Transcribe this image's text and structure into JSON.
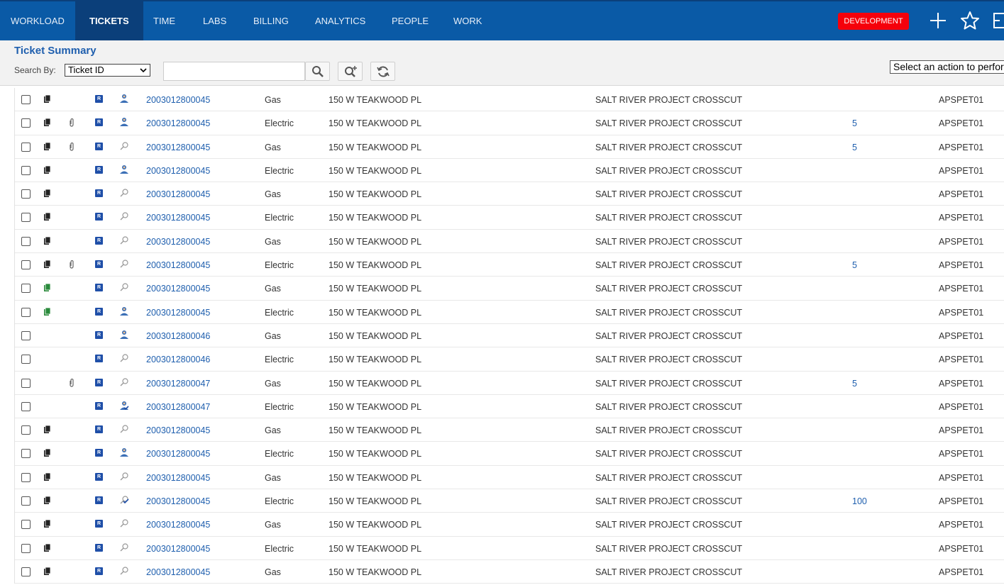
{
  "nav": {
    "items": [
      {
        "label": "WORKLOAD",
        "active": false
      },
      {
        "label": "TICKETS",
        "active": true
      },
      {
        "label": "TIME",
        "active": false
      },
      {
        "label": "LABS",
        "active": false
      },
      {
        "label": "BILLING",
        "active": false
      },
      {
        "label": "ANALYTICS",
        "active": false
      },
      {
        "label": "PEOPLE",
        "active": false
      },
      {
        "label": "WORK",
        "active": false
      }
    ],
    "env_badge": "DEVELOPMENT",
    "icons": [
      "plus-icon",
      "star-icon",
      "exit-icon"
    ]
  },
  "header": {
    "title": "Ticket Summary",
    "search_by_label": "Search By:",
    "search_by_value": "Ticket ID",
    "search_value": "",
    "action_select": "Select an action to perform"
  },
  "colors": {
    "nav_bg": "#0a5aa6",
    "nav_active": "#0b3f7a",
    "badge": "#f5000b",
    "link": "#1f5fae"
  },
  "tickets": [
    {
      "doc": "dark",
      "clip": false,
      "person": "agent",
      "id": "2003012800045",
      "utility": "Gas",
      "address": "150 W TEAKWOOD PL",
      "project": "SALT RIVER PROJECT CROSSCUT",
      "count": "",
      "code": "APSPET01"
    },
    {
      "doc": "dark",
      "clip": true,
      "person": "agent",
      "id": "2003012800045",
      "utility": "Electric",
      "address": "150 W TEAKWOOD PL",
      "project": "SALT RIVER PROJECT CROSSCUT",
      "count": "5",
      "code": "APSPET01"
    },
    {
      "doc": "dark",
      "clip": true,
      "person": "search",
      "id": "2003012800045",
      "utility": "Gas",
      "address": "150 W TEAKWOOD PL",
      "project": "SALT RIVER PROJECT CROSSCUT",
      "count": "5",
      "code": "APSPET01"
    },
    {
      "doc": "dark",
      "clip": false,
      "person": "agent",
      "id": "2003012800045",
      "utility": "Electric",
      "address": "150 W TEAKWOOD PL",
      "project": "SALT RIVER PROJECT CROSSCUT",
      "count": "",
      "code": "APSPET01"
    },
    {
      "doc": "dark",
      "clip": false,
      "person": "search",
      "id": "2003012800045",
      "utility": "Gas",
      "address": "150 W TEAKWOOD PL",
      "project": "SALT RIVER PROJECT CROSSCUT",
      "count": "",
      "code": "APSPET01"
    },
    {
      "doc": "dark",
      "clip": false,
      "person": "search",
      "id": "2003012800045",
      "utility": "Electric",
      "address": "150 W TEAKWOOD PL",
      "project": "SALT RIVER PROJECT CROSSCUT",
      "count": "",
      "code": "APSPET01"
    },
    {
      "doc": "dark",
      "clip": false,
      "person": "search",
      "id": "2003012800045",
      "utility": "Gas",
      "address": "150 W TEAKWOOD PL",
      "project": "SALT RIVER PROJECT CROSSCUT",
      "count": "",
      "code": "APSPET01"
    },
    {
      "doc": "dark",
      "clip": true,
      "person": "search",
      "id": "2003012800045",
      "utility": "Electric",
      "address": "150 W TEAKWOOD PL",
      "project": "SALT RIVER PROJECT CROSSCUT",
      "count": "5",
      "code": "APSPET01"
    },
    {
      "doc": "green",
      "clip": false,
      "person": "search",
      "id": "2003012800045",
      "utility": "Gas",
      "address": "150 W TEAKWOOD PL",
      "project": "SALT RIVER PROJECT CROSSCUT",
      "count": "",
      "code": "APSPET01"
    },
    {
      "doc": "green",
      "clip": false,
      "person": "agent",
      "id": "2003012800045",
      "utility": "Electric",
      "address": "150 W TEAKWOOD PL",
      "project": "SALT RIVER PROJECT CROSSCUT",
      "count": "",
      "code": "APSPET01"
    },
    {
      "doc": "",
      "clip": false,
      "person": "agent",
      "id": "2003012800046",
      "utility": "Gas",
      "address": "150 W TEAKWOOD PL",
      "project": "SALT RIVER PROJECT CROSSCUT",
      "count": "",
      "code": "APSPET01"
    },
    {
      "doc": "",
      "clip": false,
      "person": "search",
      "id": "2003012800046",
      "utility": "Electric",
      "address": "150 W TEAKWOOD PL",
      "project": "SALT RIVER PROJECT CROSSCUT",
      "count": "",
      "code": "APSPET01"
    },
    {
      "doc": "",
      "clip": true,
      "person": "search",
      "id": "2003012800047",
      "utility": "Gas",
      "address": "150 W TEAKWOOD PL",
      "project": "SALT RIVER PROJECT CROSSCUT",
      "count": "5",
      "code": "APSPET01"
    },
    {
      "doc": "",
      "clip": false,
      "person": "agent-check",
      "id": "2003012800047",
      "utility": "Electric",
      "address": "150 W TEAKWOOD PL",
      "project": "SALT RIVER PROJECT CROSSCUT",
      "count": "",
      "code": "APSPET01"
    },
    {
      "doc": "dark",
      "clip": false,
      "person": "search",
      "id": "2003012800045",
      "utility": "Gas",
      "address": "150 W TEAKWOOD PL",
      "project": "SALT RIVER PROJECT CROSSCUT",
      "count": "",
      "code": "APSPET01"
    },
    {
      "doc": "dark",
      "clip": false,
      "person": "agent",
      "id": "2003012800045",
      "utility": "Electric",
      "address": "150 W TEAKWOOD PL",
      "project": "SALT RIVER PROJECT CROSSCUT",
      "count": "",
      "code": "APSPET01"
    },
    {
      "doc": "dark",
      "clip": false,
      "person": "search",
      "id": "2003012800045",
      "utility": "Gas",
      "address": "150 W TEAKWOOD PL",
      "project": "SALT RIVER PROJECT CROSSCUT",
      "count": "",
      "code": "APSPET01"
    },
    {
      "doc": "dark",
      "clip": false,
      "person": "search-check",
      "id": "2003012800045",
      "utility": "Electric",
      "address": "150 W TEAKWOOD PL",
      "project": "SALT RIVER PROJECT CROSSCUT",
      "count": "100",
      "code": "APSPET01"
    },
    {
      "doc": "dark",
      "clip": false,
      "person": "search",
      "id": "2003012800045",
      "utility": "Gas",
      "address": "150 W TEAKWOOD PL",
      "project": "SALT RIVER PROJECT CROSSCUT",
      "count": "",
      "code": "APSPET01"
    },
    {
      "doc": "dark",
      "clip": false,
      "person": "search",
      "id": "2003012800045",
      "utility": "Electric",
      "address": "150 W TEAKWOOD PL",
      "project": "SALT RIVER PROJECT CROSSCUT",
      "count": "",
      "code": "APSPET01"
    },
    {
      "doc": "dark",
      "clip": false,
      "person": "search",
      "id": "2003012800045",
      "utility": "Gas",
      "address": "150 W TEAKWOOD PL",
      "project": "SALT RIVER PROJECT CROSSCUT",
      "count": "",
      "code": "APSPET01"
    }
  ]
}
